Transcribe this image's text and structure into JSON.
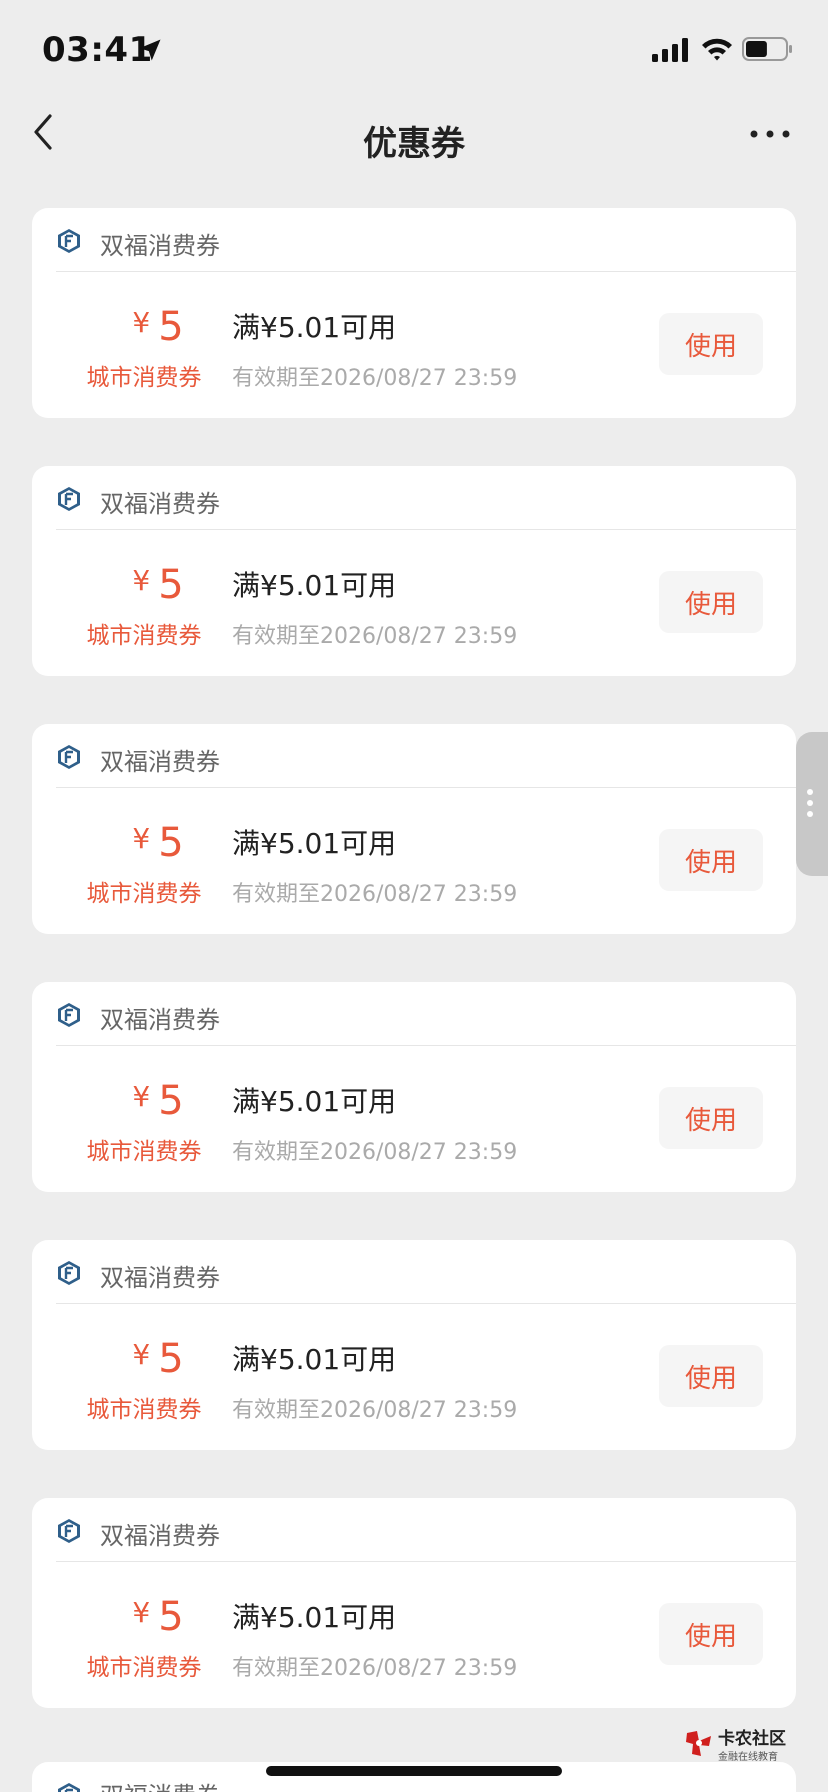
{
  "status_bar": {
    "time": "03:41",
    "location_icon": "location-arrow-icon",
    "signal_icon": "cellular-signal-icon",
    "wifi_icon": "wifi-icon",
    "battery_icon": "battery-icon",
    "battery_level": 0.55
  },
  "nav": {
    "title": "优惠券",
    "back_icon": "chevron-left-icon",
    "more_icon": "more-dots-icon"
  },
  "colors": {
    "accent": "#e8593b",
    "background": "#ededed",
    "card": "#ffffff",
    "muted_text": "#aaaaaa"
  },
  "coupons": [
    {
      "brand": "双福消费券",
      "currency": "¥",
      "amount": "5",
      "type": "城市消费券",
      "condition": "满¥5.01可用",
      "expiry": "有效期至2026/08/27 23:59",
      "button": "使用"
    },
    {
      "brand": "双福消费券",
      "currency": "¥",
      "amount": "5",
      "type": "城市消费券",
      "condition": "满¥5.01可用",
      "expiry": "有效期至2026/08/27 23:59",
      "button": "使用"
    },
    {
      "brand": "双福消费券",
      "currency": "¥",
      "amount": "5",
      "type": "城市消费券",
      "condition": "满¥5.01可用",
      "expiry": "有效期至2026/08/27 23:59",
      "button": "使用"
    },
    {
      "brand": "双福消费券",
      "currency": "¥",
      "amount": "5",
      "type": "城市消费券",
      "condition": "满¥5.01可用",
      "expiry": "有效期至2026/08/27 23:59",
      "button": "使用"
    },
    {
      "brand": "双福消费券",
      "currency": "¥",
      "amount": "5",
      "type": "城市消费券",
      "condition": "满¥5.01可用",
      "expiry": "有效期至2026/08/27 23:59",
      "button": "使用"
    },
    {
      "brand": "双福消费券",
      "currency": "¥",
      "amount": "5",
      "type": "城市消费券",
      "condition": "满¥5.01可用",
      "expiry": "有效期至2026/08/27 23:59",
      "button": "使用"
    }
  ],
  "partial_coupon": {
    "brand": "双福消费券"
  },
  "watermark": {
    "title": "卡农社区",
    "subtitle": "金融在线教育",
    "logo_icon": "kanong-logo-icon"
  }
}
